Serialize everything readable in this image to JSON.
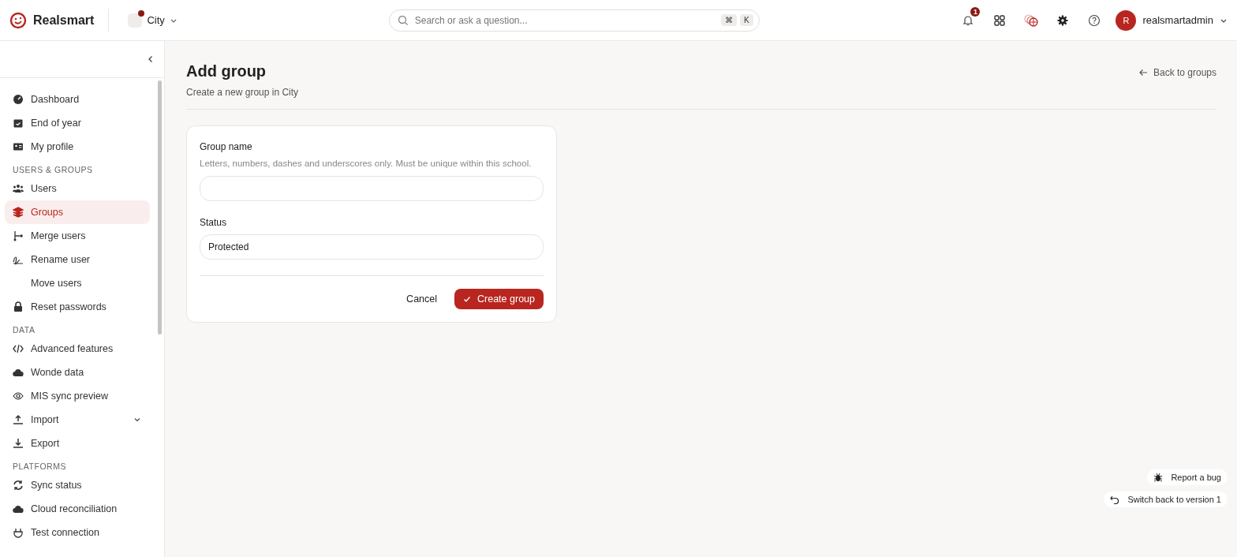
{
  "header": {
    "brand": "Realsmart",
    "school": {
      "name": "City",
      "alert": true
    },
    "search": {
      "placeholder": "Search or ask a question...",
      "keys": [
        "⌘",
        "K"
      ]
    },
    "notifications": "1",
    "user": {
      "initial": "R",
      "name": "realsmartadmin"
    }
  },
  "sidebar": {
    "sections": [
      {
        "items": [
          {
            "label": "Dashboard",
            "selected": false
          },
          {
            "label": "End of year",
            "selected": false
          },
          {
            "label": "My profile",
            "selected": false
          }
        ]
      },
      {
        "heading": "USERS & GROUPS",
        "items": [
          {
            "label": "Users",
            "selected": false
          },
          {
            "label": "Groups",
            "selected": true
          },
          {
            "label": "Merge users",
            "selected": false
          },
          {
            "label": "Rename user",
            "selected": false
          },
          {
            "label": "Move users",
            "selected": false
          },
          {
            "label": "Reset passwords",
            "selected": false
          }
        ]
      },
      {
        "heading": "DATA",
        "items": [
          {
            "label": "Advanced features",
            "selected": false
          },
          {
            "label": "Wonde data",
            "selected": false
          },
          {
            "label": "MIS sync preview",
            "selected": false
          },
          {
            "label": "Import",
            "selected": false,
            "expanded": false
          },
          {
            "label": "Export",
            "selected": false
          }
        ]
      },
      {
        "heading": "PLATFORMS",
        "items": [
          {
            "label": "Sync status",
            "selected": false
          },
          {
            "label": "Cloud reconciliation",
            "selected": false
          },
          {
            "label": "Test connection",
            "selected": false
          }
        ]
      }
    ]
  },
  "page": {
    "title": "Add group",
    "subtitle": "Create a new group in City",
    "back_link": "Back to groups"
  },
  "form": {
    "fields": [
      {
        "kind": "text",
        "label": "Group name",
        "help": "Letters, numbers, dashes and underscores only. Must be unique within this school."
      },
      {
        "kind": "select",
        "label": "Status",
        "value": "Protected"
      }
    ],
    "buttons": [
      {
        "kind": "secondary",
        "label": "Cancel"
      },
      {
        "kind": "primary",
        "label": "Create group"
      }
    ]
  },
  "floating": [
    {
      "label": "Report a bug"
    },
    {
      "label": "Switch back to version 1"
    }
  ]
}
